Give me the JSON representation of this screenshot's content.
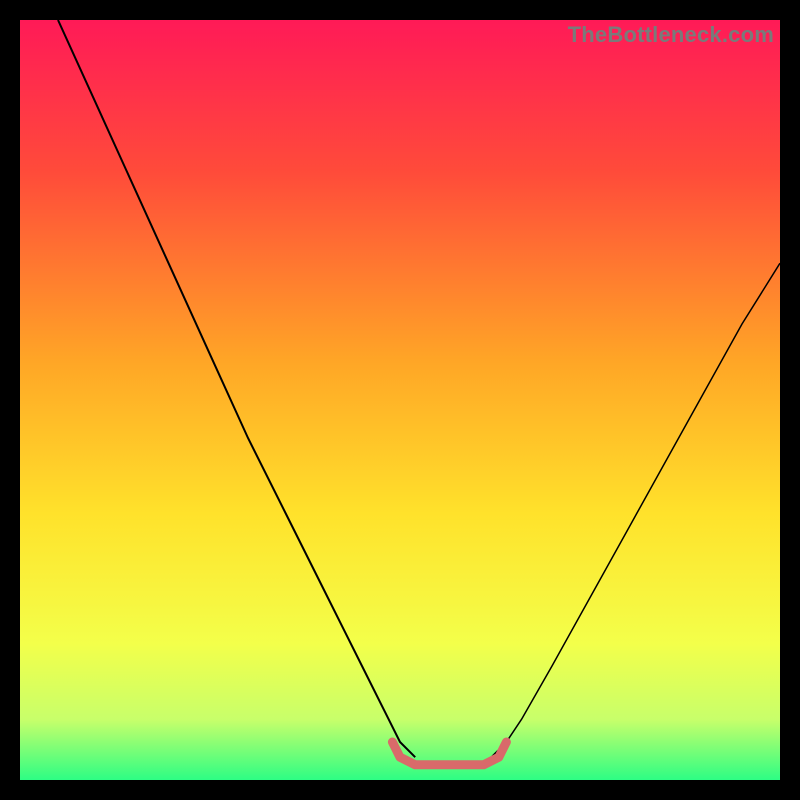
{
  "watermark": "TheBottleneck.com",
  "chart_data": {
    "type": "line",
    "title": "",
    "xlabel": "",
    "ylabel": "",
    "xlim": [
      0,
      100
    ],
    "ylim": [
      0,
      100
    ],
    "grid": false,
    "legend": false,
    "background_gradient": {
      "stops": [
        {
          "offset": 0.0,
          "color": "#ff1a57"
        },
        {
          "offset": 0.2,
          "color": "#ff4b3a"
        },
        {
          "offset": 0.45,
          "color": "#ffa626"
        },
        {
          "offset": 0.65,
          "color": "#ffe22b"
        },
        {
          "offset": 0.82,
          "color": "#f3ff4a"
        },
        {
          "offset": 0.92,
          "color": "#c8ff6a"
        },
        {
          "offset": 1.0,
          "color": "#2dfd84"
        }
      ]
    },
    "series": [
      {
        "name": "bottleneck-curve-left",
        "color": "#000000",
        "width": 2,
        "x": [
          5,
          10,
          15,
          20,
          25,
          30,
          35,
          40,
          45,
          48,
          50,
          52
        ],
        "y": [
          100,
          89,
          78,
          67,
          56,
          45,
          35,
          25,
          15,
          9,
          5,
          3
        ]
      },
      {
        "name": "bottleneck-curve-right",
        "color": "#000000",
        "width": 1.5,
        "x": [
          62,
          64,
          66,
          70,
          75,
          80,
          85,
          90,
          95,
          100
        ],
        "y": [
          3,
          5,
          8,
          15,
          24,
          33,
          42,
          51,
          60,
          68
        ]
      },
      {
        "name": "optimal-zone-marker",
        "color": "#d96a6a",
        "width": 9,
        "linecap": "round",
        "x": [
          49,
          50,
          52,
          55,
          58,
          61,
          63,
          64
        ],
        "y": [
          5,
          3,
          2,
          2,
          2,
          2,
          3,
          5
        ]
      }
    ]
  }
}
